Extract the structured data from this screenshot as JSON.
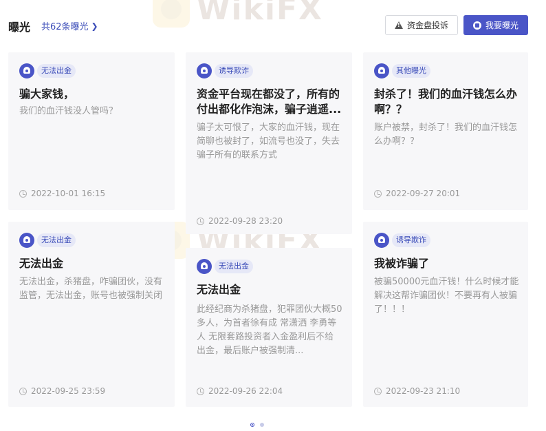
{
  "header": {
    "title": "曝光",
    "count_link": "共62条曝光",
    "complaint_button": "资金盘投诉",
    "expose_button": "我要曝光"
  },
  "cards": [
    {
      "tag": "无法出金",
      "title": "骗大家钱，",
      "desc": "我们的血汗钱没人管吗？",
      "time": "2022-10-01 16:15"
    },
    {
      "tag": "诱导欺诈",
      "title": "资金平台现在都没了，所有的付出都化作泡沫，骗子逍遥...",
      "desc": "骗子太可恨了，大家的血汗钱，现在简聊也被封了，如流号也没了，失去骗子所有的联系方式",
      "time": "2022-09-28 23:20"
    },
    {
      "tag": "其他曝光",
      "title": "封杀了！我们的血汗钱怎么办啊？？",
      "desc": "账户被禁，封杀了！我们的血汗钱怎么办啊？？",
      "time": "2022-09-27 20:01"
    },
    {
      "tag": "无法出金",
      "title": "无法出金",
      "desc": "无法出金，杀猪盘，咋骗团伙，没有监管，无法出金，账号也被强制关闭",
      "time": "2022-09-25 23:59"
    },
    {
      "tag": "无法出金",
      "title": "无法出金",
      "desc": "此经纪商为杀猪盘，犯罪团伙大概50多人，为首者徐有成 常潇洒 李勇等人 无限套路投资者入金盈利后不给出金，最后账户被强制清...",
      "time": "2022-09-26 22:04"
    },
    {
      "tag": "诱导欺诈",
      "title": "我被诈骗了",
      "desc": "被骗50000元血汗钱！什么时候才能解决这帮诈骗团伙！不要再有人被骗了！！！",
      "time": "2022-09-23 21:10"
    }
  ],
  "pagination": {
    "pages": 2,
    "current": 1
  },
  "colors": {
    "accent": "#4a55c7",
    "card_bg": "#f7f7f9",
    "muted": "#999999"
  },
  "watermark": "WikiFX"
}
